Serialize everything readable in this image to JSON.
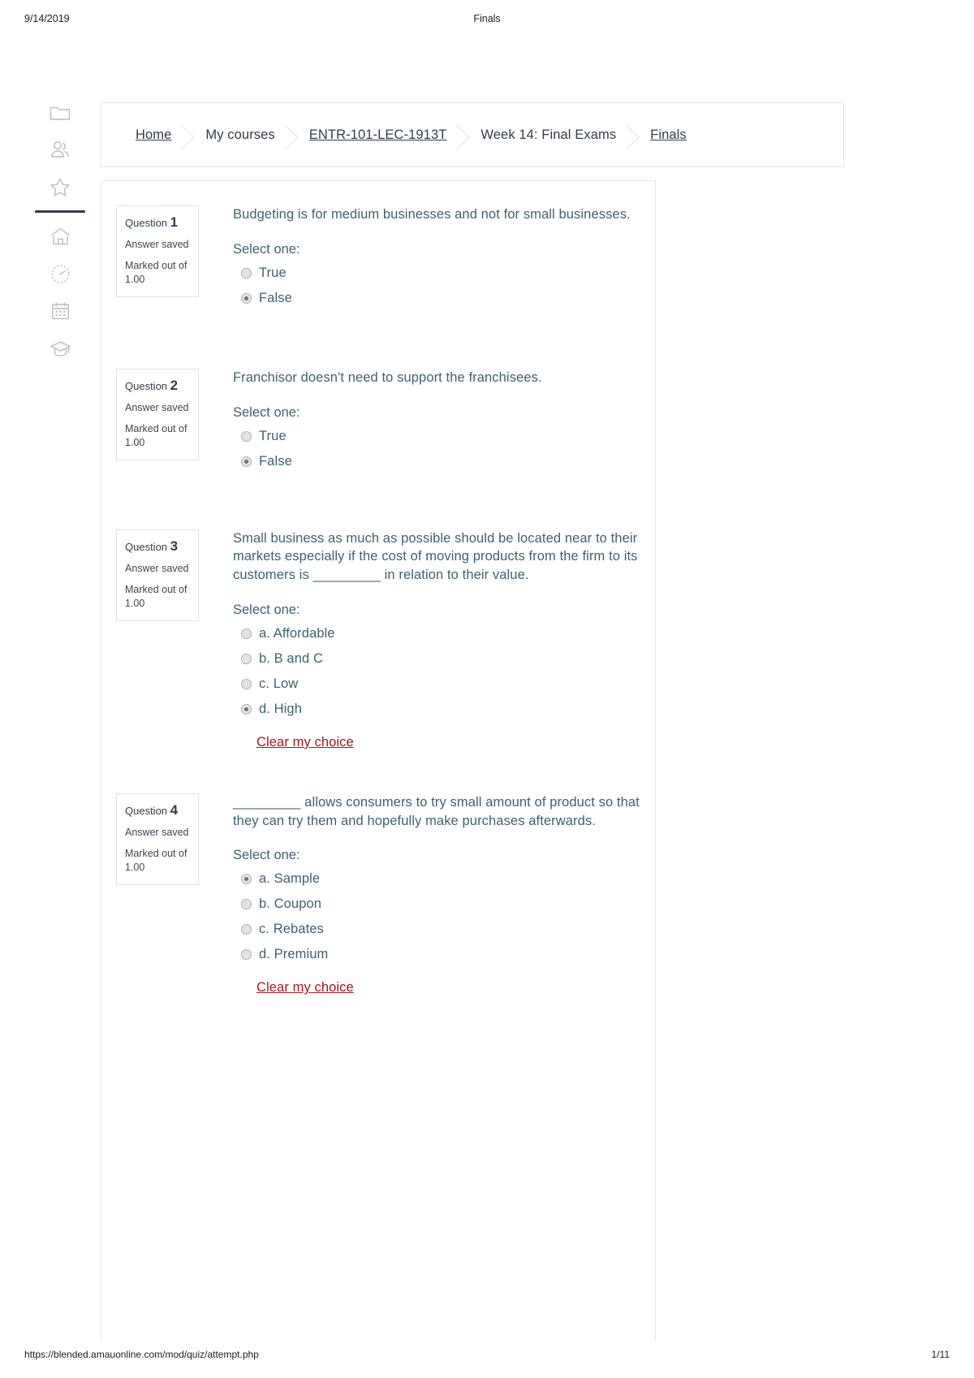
{
  "print": {
    "date": "9/14/2019",
    "title": "Finals",
    "url": "https://blended.amauonline.com/mod/quiz/attempt.php",
    "page": "1/11"
  },
  "theme": {
    "question_text_color": "#3c6272",
    "info_text_color": "#2f3d4c",
    "clear_link_color": "#a31621",
    "rail_icon_color": "#b9bcc2",
    "rail_divider_color": "#2f3d4c",
    "card_border_color": "#e6e8ea"
  },
  "sidebar": {
    "items": [
      {
        "icon": "folder-icon",
        "label": "Files"
      },
      {
        "icon": "users-icon",
        "label": "Participants"
      },
      {
        "icon": "star-icon",
        "label": "Favorites"
      },
      {
        "icon": "divider",
        "label": ""
      },
      {
        "icon": "home-icon",
        "label": "Home"
      },
      {
        "icon": "dashboard-icon",
        "label": "Dashboard"
      },
      {
        "icon": "calendar-icon",
        "label": "Calendar"
      },
      {
        "icon": "graduation-cap-icon",
        "label": "My courses"
      }
    ]
  },
  "breadcrumb": {
    "items": [
      {
        "label": "Home",
        "link": true
      },
      {
        "label": "My courses",
        "link": false
      },
      {
        "label": "ENTR-101-LEC-1913T",
        "link": true
      },
      {
        "label": "Week 14: Final Exams",
        "link": false
      },
      {
        "label": "Finals",
        "link": true
      }
    ]
  },
  "quiz": {
    "questions": [
      {
        "info": {
          "prefix": "Question",
          "number": "1",
          "status": "Answer saved",
          "marked_out_of": "Marked out of 1.00"
        },
        "text": "Budgeting is for medium businesses and not for small businesses.",
        "select_one": "Select one:",
        "options": [
          {
            "label": "True",
            "checked": false
          },
          {
            "label": "False",
            "checked": true
          }
        ],
        "clear_choice": null
      },
      {
        "info": {
          "prefix": "Question",
          "number": "2",
          "status": "Answer saved",
          "marked_out_of": "Marked out of 1.00"
        },
        "text": "Franchisor doesn't need to support the franchisees.",
        "select_one": "Select one:",
        "options": [
          {
            "label": "True",
            "checked": false
          },
          {
            "label": "False",
            "checked": true
          }
        ],
        "clear_choice": null
      },
      {
        "info": {
          "prefix": "Question",
          "number": "3",
          "status": "Answer saved",
          "marked_out_of": "Marked out of 1.00"
        },
        "text": "Small business as much as possible should be located near to their markets especially if the cost of moving products from the firm to its customers is _________ in relation to their value.",
        "select_one": "Select one:",
        "options": [
          {
            "label": "a. Affordable",
            "checked": false
          },
          {
            "label": "b. B and C",
            "checked": false
          },
          {
            "label": "c. Low",
            "checked": false
          },
          {
            "label": "d. High",
            "checked": true
          }
        ],
        "clear_choice": "Clear my choice"
      },
      {
        "info": {
          "prefix": "Question",
          "number": "4",
          "status": "Answer saved",
          "marked_out_of": "Marked out of 1.00"
        },
        "text": "_________ allows consumers to try small amount of product so that they can try them and hopefully make purchases afterwards.",
        "select_one": "Select one:",
        "options": [
          {
            "label": "a. Sample",
            "checked": true
          },
          {
            "label": "b. Coupon",
            "checked": false
          },
          {
            "label": "c. Rebates",
            "checked": false
          },
          {
            "label": "d. Premium",
            "checked": false
          }
        ],
        "clear_choice": "Clear my choice"
      }
    ]
  }
}
